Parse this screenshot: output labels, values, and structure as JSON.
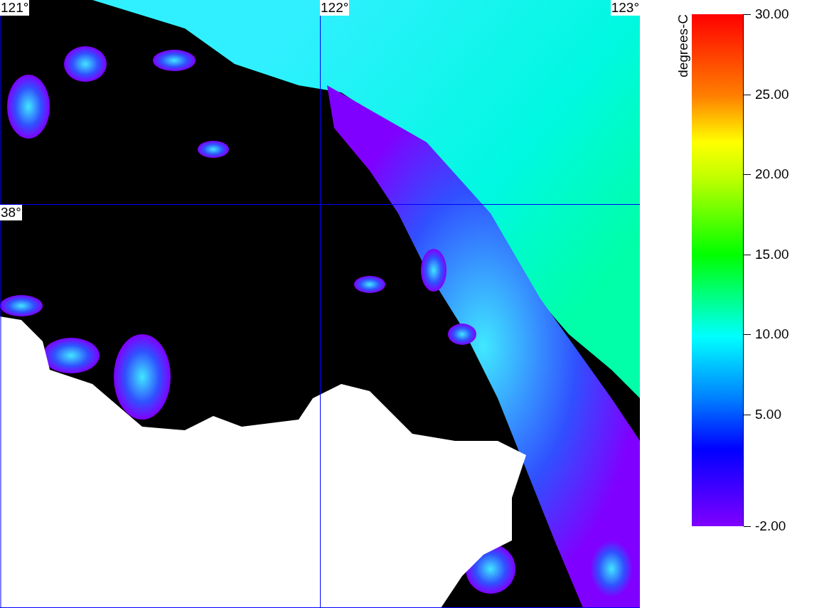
{
  "map": {
    "meridians": [
      {
        "label": "121°"
      },
      {
        "label": "122°"
      },
      {
        "label": "123°"
      }
    ],
    "parallels": [
      {
        "label": "38°"
      }
    ]
  },
  "colorbar": {
    "label": "degrees-C",
    "ticks": [
      "30.00",
      "25.00",
      "20.00",
      "15.00",
      "10.00",
      "5.00",
      "-2.00"
    ]
  }
}
